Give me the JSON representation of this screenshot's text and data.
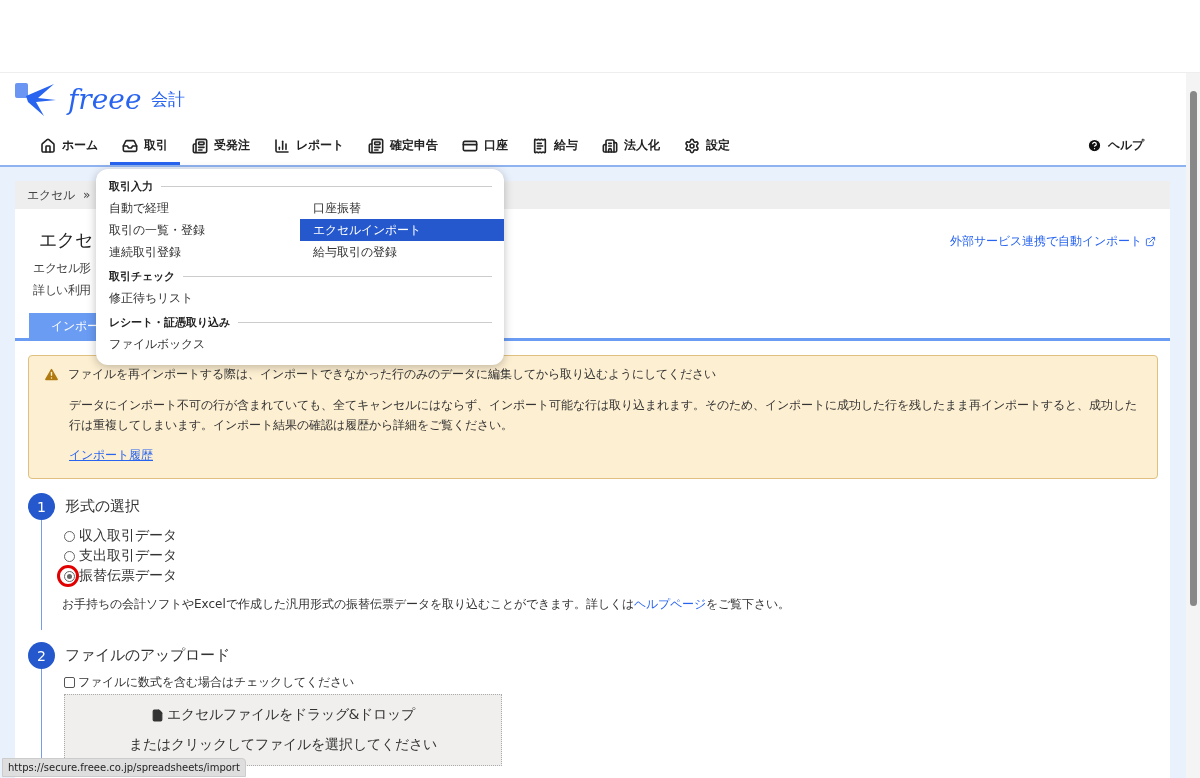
{
  "logo": {
    "brand": "freee",
    "product": "会計"
  },
  "nav": {
    "items": [
      {
        "label": "ホーム",
        "selected": false
      },
      {
        "label": "取引",
        "selected": true
      },
      {
        "label": "受発注",
        "selected": false
      },
      {
        "label": "レポート",
        "selected": false
      },
      {
        "label": "確定申告",
        "selected": false
      },
      {
        "label": "口座",
        "selected": false
      },
      {
        "label": "給与",
        "selected": false
      },
      {
        "label": "法人化",
        "selected": false
      },
      {
        "label": "設定",
        "selected": false
      }
    ],
    "help": "ヘルプ"
  },
  "menu": {
    "sections": [
      {
        "title": "取引入力",
        "items": [
          {
            "label": "自動で経理",
            "selected": false
          },
          {
            "label": "口座振替",
            "selected": false
          },
          {
            "label": "取引の一覧・登録",
            "selected": false
          },
          {
            "label": "エクセルインポート",
            "selected": true
          },
          {
            "label": "連続取引登録",
            "selected": false
          },
          {
            "label": "給与取引の登録",
            "selected": false
          }
        ]
      },
      {
        "title": "取引チェック",
        "items": [
          {
            "label": "修正待ちリスト",
            "selected": false
          }
        ]
      },
      {
        "title": "レシート・証憑取り込み",
        "items": [
          {
            "label": "ファイルボックス",
            "selected": false
          }
        ]
      }
    ]
  },
  "breadcrumb": {
    "items": [
      "エクセル"
    ],
    "separator": "»"
  },
  "page": {
    "title": "エクセ",
    "description": [
      "エクセル形",
      "詳しい利用"
    ],
    "external_link": "外部サービス連携で自動インポート"
  },
  "tabs": [
    {
      "label": "インポー",
      "selected": true
    }
  ],
  "alert": {
    "heading": "ファイルを再インポートする際は、インポートできなかった行のみのデータに編集してから取り込むようにしてください",
    "body": "データにインポート不可の行が含まれていても、全てキャンセルにはならず、インポート可能な行は取り込まれます。そのため、インポートに成功した行を残したまま再インポートすると、成功した行は重複してしまいます。インポート結果の確認は履歴から詳細をご覧ください。",
    "link": "インポート履歴"
  },
  "step1": {
    "number": "1",
    "title": "形式の選択",
    "options": [
      {
        "label": "収入取引データ",
        "selected": false,
        "circled": false
      },
      {
        "label": "支出取引データ",
        "selected": false,
        "circled": false
      },
      {
        "label": "振替伝票データ",
        "selected": true,
        "circled": true
      }
    ],
    "note_before": "お手持ちの会計ソフトやExcelで作成した汎用形式の振替伝票データを取り込むことができます。詳しくは",
    "note_link": "ヘルプページ",
    "note_after": "をご覧下さい。"
  },
  "step2": {
    "number": "2",
    "title": "ファイルのアップロード",
    "checkbox": {
      "label": "ファイルに数式を含む場合はチェックしてください",
      "checked": false
    },
    "dropzone": {
      "line1": "エクセルファイルをドラッグ&ドロップ",
      "line2": "またはクリックしてファイルを選択してください"
    }
  },
  "status_url": "https://secure.freee.co.jp/spreadsheets/import"
}
